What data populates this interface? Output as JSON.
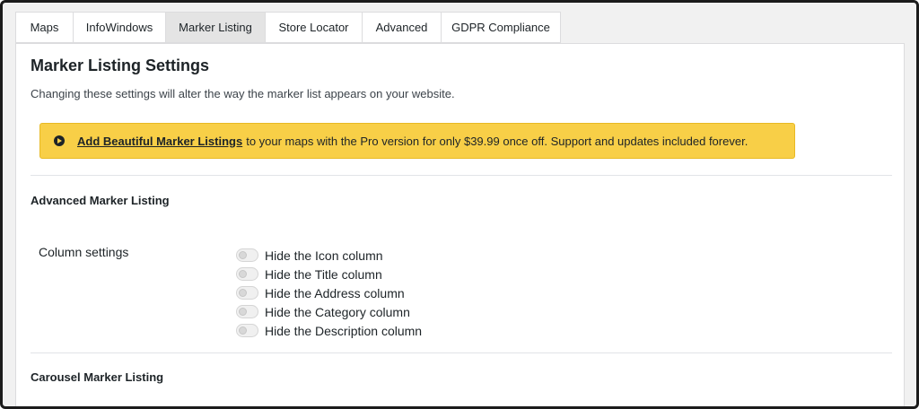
{
  "tabs": [
    {
      "label": "Maps",
      "active": false
    },
    {
      "label": "InfoWindows",
      "active": false
    },
    {
      "label": "Marker Listing",
      "active": true
    },
    {
      "label": "Store Locator",
      "active": false
    },
    {
      "label": "Advanced",
      "active": false
    },
    {
      "label": "GDPR Compliance",
      "active": false
    }
  ],
  "settings": {
    "title": "Marker Listing Settings",
    "description": "Changing these settings will alter the way the marker list appears on your website."
  },
  "notice": {
    "icon": "arrow-circle-right-icon",
    "link_text": "Add Beautiful Marker Listings",
    "body_text": "to your maps with the Pro version for only $39.99 once off. Support and updates included forever.",
    "color": "#f8cf47"
  },
  "advanced": {
    "heading": "Advanced Marker Listing",
    "column_settings_label": "Column settings",
    "options": [
      {
        "label": "Hide the Icon column",
        "checked": false
      },
      {
        "label": "Hide the Title column",
        "checked": false
      },
      {
        "label": "Hide the Address column",
        "checked": false
      },
      {
        "label": "Hide the Category column",
        "checked": false
      },
      {
        "label": "Hide the Description column",
        "checked": false
      }
    ]
  },
  "carousel": {
    "heading": "Carousel Marker Listing"
  }
}
